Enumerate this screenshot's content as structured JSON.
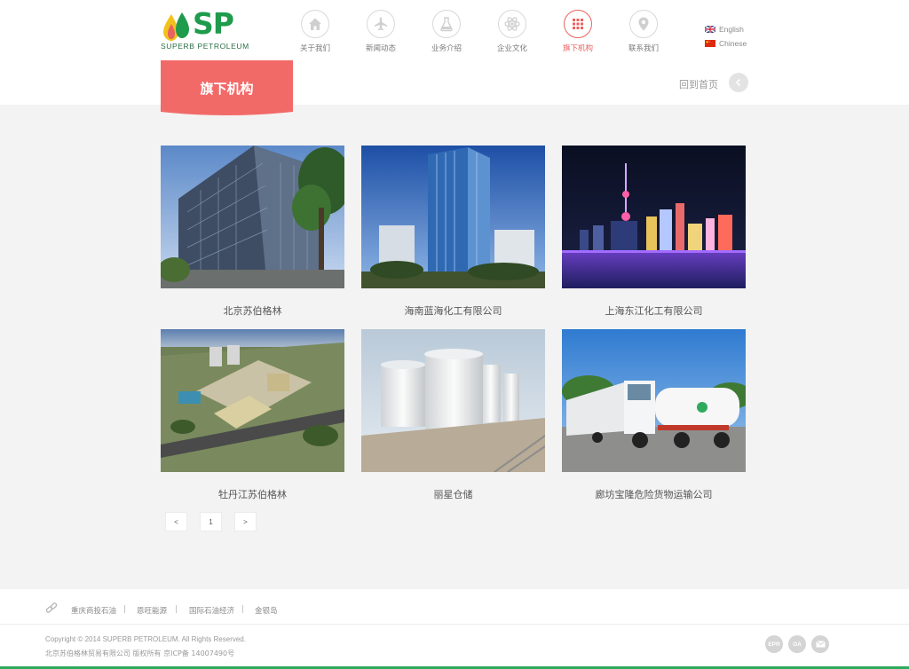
{
  "brand": {
    "name": "SP",
    "subtitle": "SUPERB PETROLEUM",
    "green": "#1e9b4c",
    "yellow": "#f1c21b",
    "red": "#e8625f"
  },
  "nav": {
    "items": [
      {
        "label": "关于我们",
        "icon": "home-icon"
      },
      {
        "label": "新闻动态",
        "icon": "airplane-icon"
      },
      {
        "label": "业务介绍",
        "icon": "flask-icon"
      },
      {
        "label": "企业文化",
        "icon": "atom-icon"
      },
      {
        "label": "旗下机构",
        "icon": "grid-icon",
        "active": true
      },
      {
        "label": "联系我们",
        "icon": "location-pin-icon"
      }
    ]
  },
  "lang": {
    "english": "English",
    "chinese": "Chinese"
  },
  "page": {
    "title": "旗下机构",
    "home_link": "回到首页"
  },
  "cards": [
    {
      "caption": "北京苏伯格林",
      "image": "office-tower-photo"
    },
    {
      "caption": "海南蓝海化工有限公司",
      "image": "blue-glass-tower-photo"
    },
    {
      "caption": "上海东江化工有限公司",
      "image": "shanghai-night-skyline-photo"
    },
    {
      "caption": "牡丹江苏伯格林",
      "image": "industrial-plant-aerial-photo"
    },
    {
      "caption": "丽星仓储",
      "image": "storage-tanks-photo"
    },
    {
      "caption": "廊坊宝隆危险货物运输公司",
      "image": "tanker-trucks-photo"
    }
  ],
  "pagination": {
    "prev": "<",
    "current": "1",
    "next": ">"
  },
  "footer": {
    "links": [
      "重庆商投石油",
      "恩旺能源",
      "国际石油经济",
      "金银岛"
    ],
    "separator": "|",
    "copyright": "Copyright © 2014 SUPERB PETROLEUM. All Rights Reserved.",
    "company": "北京苏伯格林贸易有限公司 版权所有 京ICP备 14007490号",
    "social": [
      "EPR",
      "OA",
      "mail-icon"
    ],
    "accent": "#2eaa5c"
  }
}
